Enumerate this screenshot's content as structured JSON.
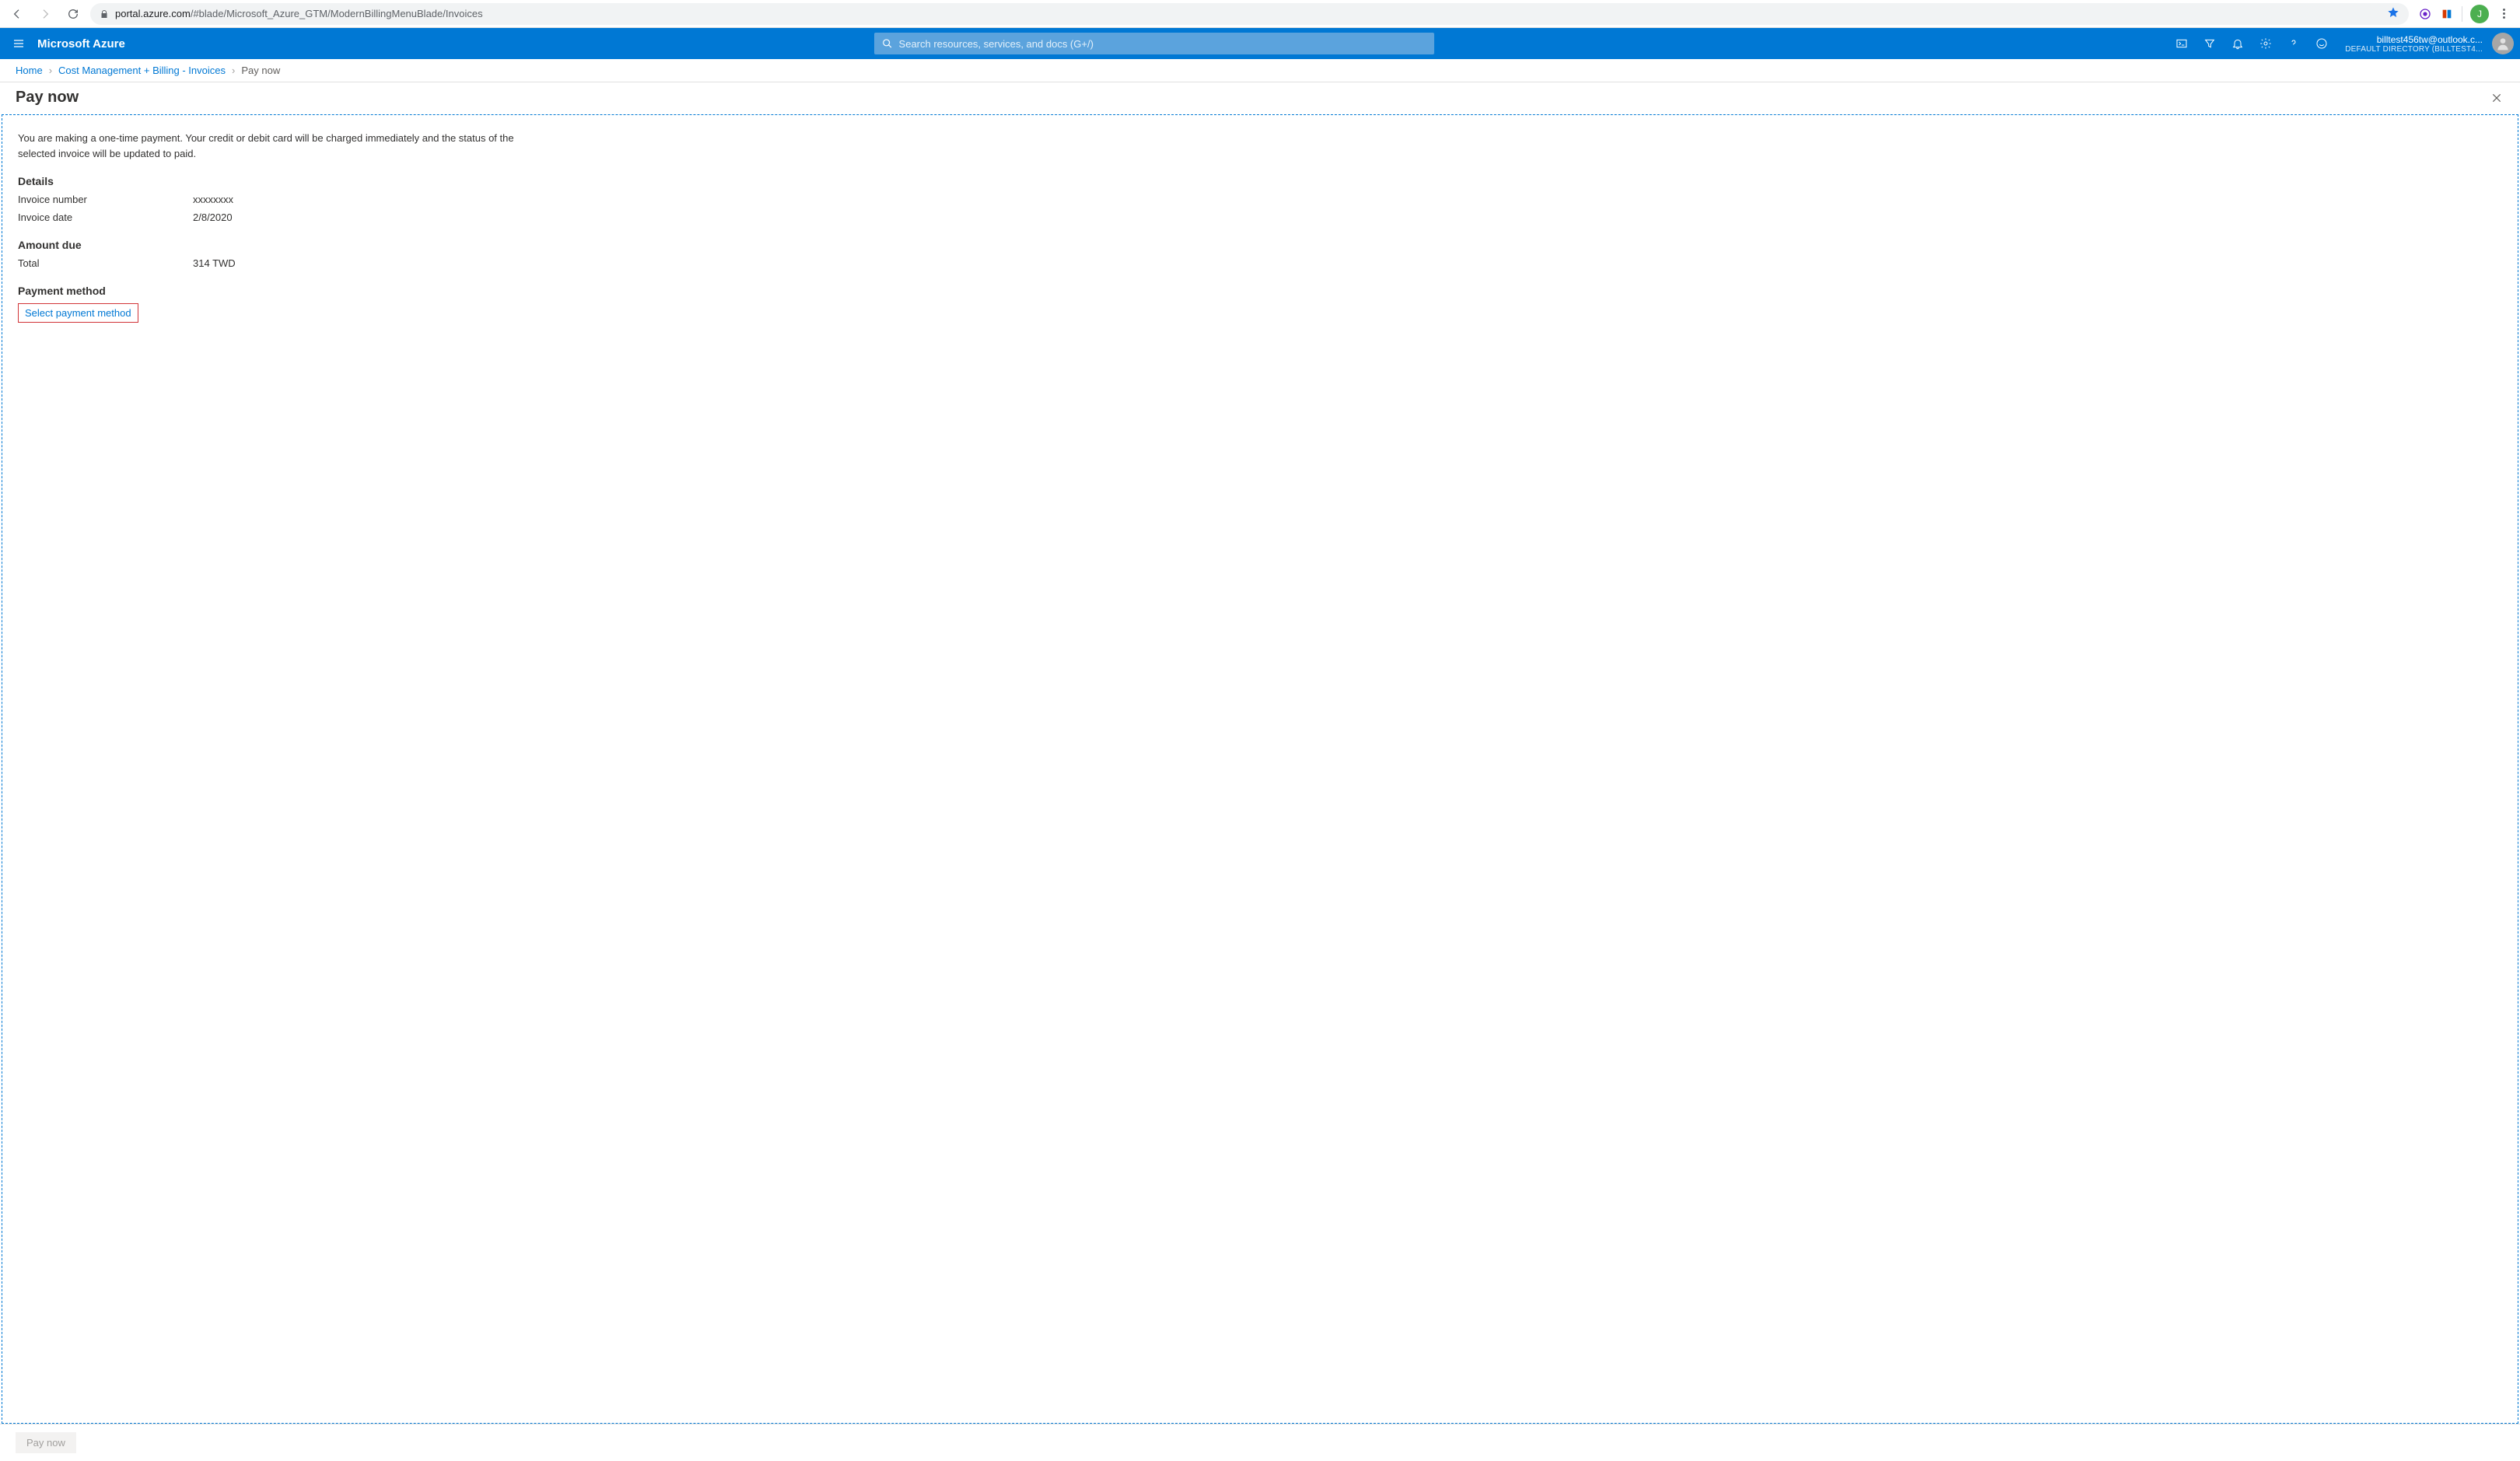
{
  "browser": {
    "url_host": "portal.azure.com",
    "url_path": "/#blade/Microsoft_Azure_GTM/ModernBillingMenuBlade/Invoices",
    "profile_initial": "J"
  },
  "header": {
    "brand": "Microsoft Azure",
    "search_placeholder": "Search resources, services, and docs (G+/)",
    "email": "billtest456tw@outlook.c...",
    "directory": "DEFAULT DIRECTORY (BILLTEST4..."
  },
  "breadcrumb": {
    "items": [
      {
        "label": "Home",
        "link": true
      },
      {
        "label": "Cost Management + Billing - Invoices",
        "link": true
      },
      {
        "label": "Pay now",
        "link": false
      }
    ]
  },
  "blade": {
    "title": "Pay now",
    "intro": "You are making a one-time payment. Your credit or debit card will be charged immediately and the status of the selected invoice will be updated to paid.",
    "sections": {
      "details_title": "Details",
      "invoice_number_label": "Invoice number",
      "invoice_number_value": "xxxxxxxx",
      "invoice_date_label": "Invoice date",
      "invoice_date_value": "2/8/2020",
      "amount_due_title": "Amount due",
      "total_label": "Total",
      "total_value": "314 TWD",
      "payment_method_title": "Payment method",
      "select_payment_label": "Select payment method"
    },
    "footer_button": "Pay now"
  }
}
